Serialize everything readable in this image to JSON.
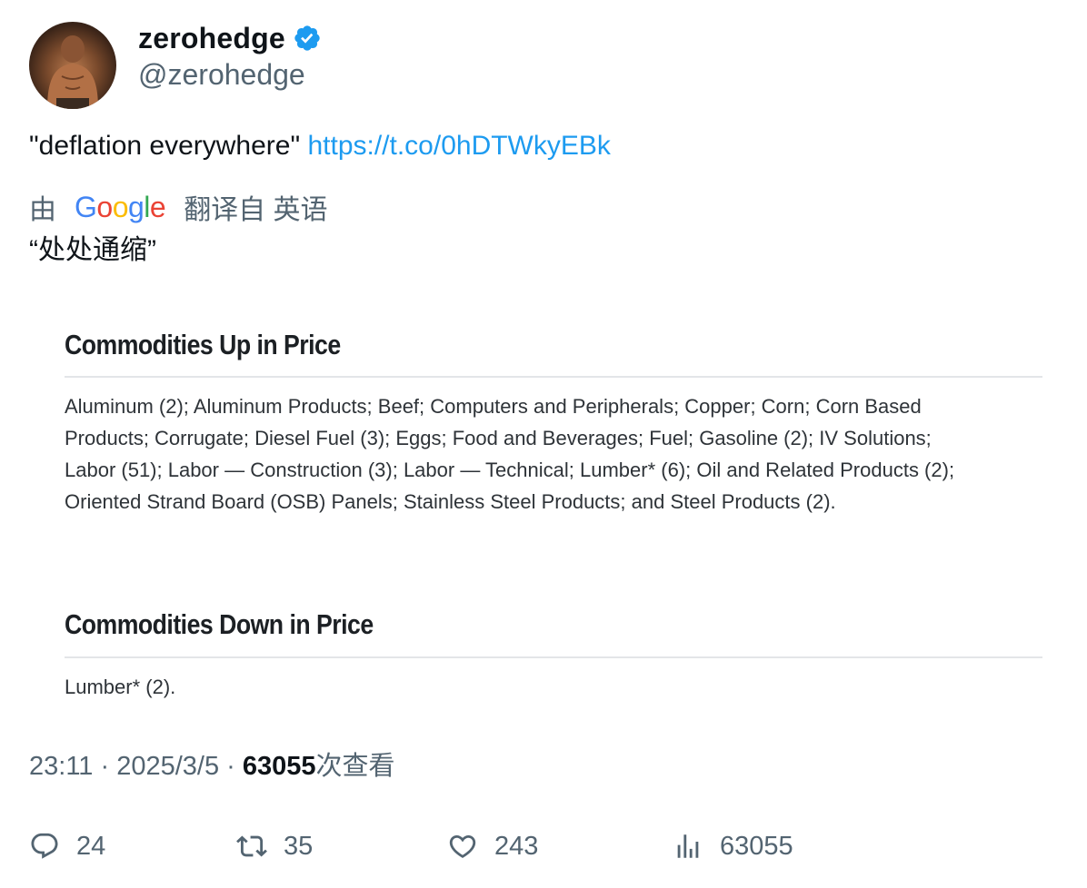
{
  "author": {
    "display_name": "zerohedge",
    "handle": "@zerohedge",
    "verified_icon": "verified-badge-icon",
    "avatar_icon": "profile-photo"
  },
  "tweet": {
    "text": "\"deflation everywhere\"",
    "link": "https://t.co/0hDTWkyEBk"
  },
  "translation": {
    "prefix": "由",
    "provider": "Google",
    "suffix": "翻译自 英语",
    "text": "“处处通缩”"
  },
  "media": {
    "section_up": {
      "heading": "Commodities Up in Price",
      "lines": [
        "Aluminum (2); Aluminum Products; Beef; Computers and Peripherals; Copper; Corn; Corn Based",
        "Products; Corrugate; Diesel Fuel (3); Eggs; Food and Beverages; Fuel; Gasoline (2); IV Solutions;",
        "Labor (51); Labor — Construction (3); Labor — Technical; Lumber* (6); Oil and Related Products (2);",
        "Oriented Strand Board (OSB) Panels; Stainless Steel Products; and Steel Products (2)."
      ]
    },
    "section_down": {
      "heading": "Commodities Down in Price",
      "lines": [
        "Lumber* (2)."
      ]
    }
  },
  "meta": {
    "time": "23:11",
    "sep1": " · ",
    "date": "2025/3/5",
    "sep2": " · ",
    "views": "63055",
    "views_label": "次查看"
  },
  "actions": {
    "reply": {
      "icon": "reply-icon",
      "count": "24"
    },
    "retweet": {
      "icon": "retweet-icon",
      "count": "35"
    },
    "like": {
      "icon": "heart-icon",
      "count": "243"
    },
    "views": {
      "icon": "analytics-icon",
      "count": "63055"
    }
  },
  "colors": {
    "link": "#1d9bf0",
    "secondary_text": "#536471",
    "primary_text": "#0f1419",
    "verified": "#1d9bf0"
  }
}
